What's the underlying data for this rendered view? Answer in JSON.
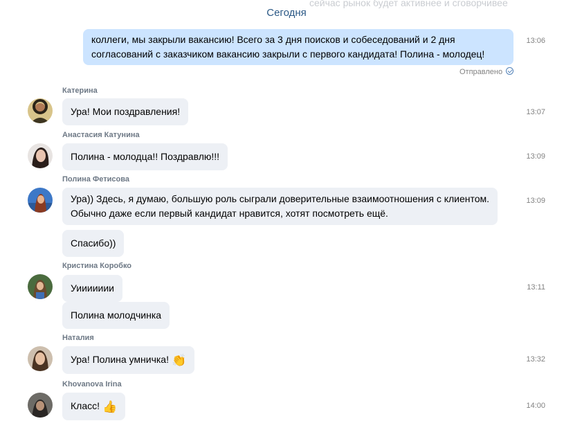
{
  "faded_top_text": "сейчас рынок будет активнее и сговорчивее",
  "date_header": "Сегодня",
  "outgoing": {
    "line1": "коллеги, мы закрыли вакансию! Всего за 3 дня поисков и собеседований и 2 дня",
    "line2": "согласований с заказчиком вакансию закрыли с первого кандидата! Полина - молодец!",
    "time": "13:06",
    "status": "Отправлено"
  },
  "messages": [
    {
      "sender": "Катерина",
      "text": "Ура! Мои поздравления!",
      "time": "13:07"
    },
    {
      "sender": "Анастасия Катунина",
      "text": "Полина - молодца!! Поздравлю!!!",
      "time": "13:09"
    },
    {
      "sender": "Полина Фетисова",
      "line1": "Ура)) Здесь, я думаю, большую роль сыграли доверительные взаимоотношения с клиентом.",
      "line2": "Обычно даже если первый кандидат нравится, хотят посмотреть ещё.",
      "extra": "Спасибо))",
      "time": "13:09"
    },
    {
      "sender": "Кристина Коробко",
      "text": "Уиииииии",
      "extra": "Полина молодчинка",
      "time": "13:11"
    },
    {
      "sender": "Наталия",
      "text": "Ура! Полина умничка!",
      "emoji": "👏",
      "time": "13:32"
    },
    {
      "sender": "Khovanova Irina",
      "text": "Класс!",
      "emoji": "👍",
      "time": "14:00"
    }
  ]
}
